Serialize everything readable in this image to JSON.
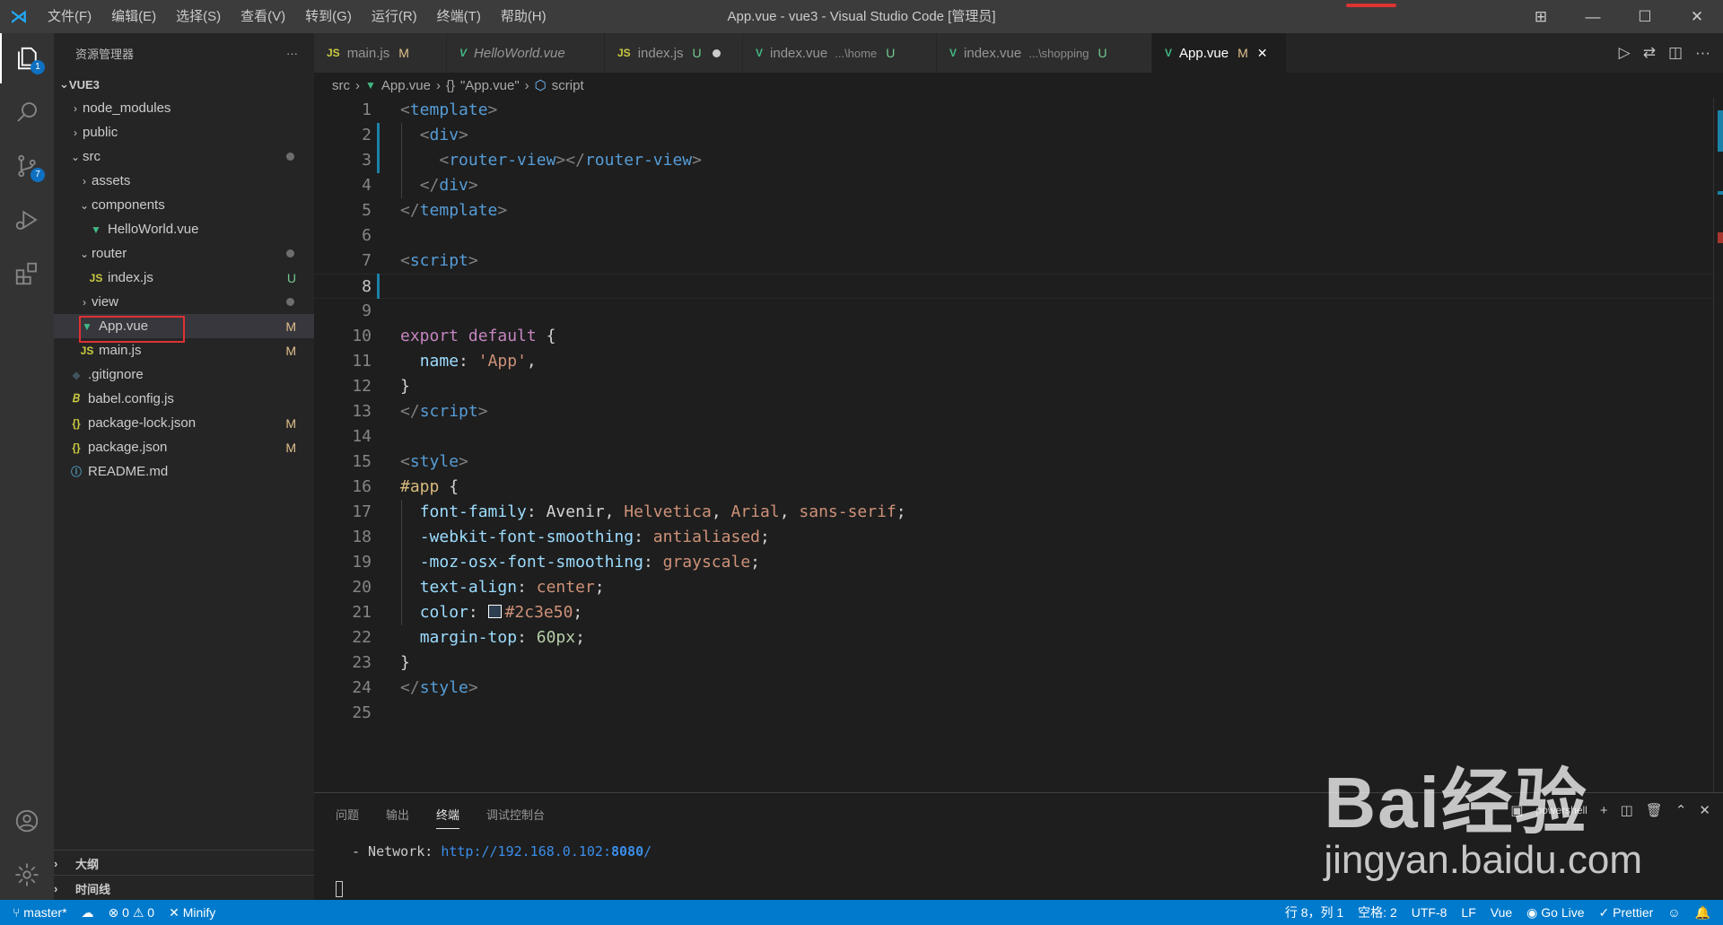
{
  "titlebar": {
    "menu": [
      "文件(F)",
      "编辑(E)",
      "选择(S)",
      "查看(V)",
      "转到(G)",
      "运行(R)",
      "终端(T)",
      "帮助(H)"
    ],
    "title": "App.vue - vue3 - Visual Studio Code [管理员]"
  },
  "activity": {
    "explorer_badge": "1",
    "scm_badge": "7"
  },
  "sidebar": {
    "header": "资源管理器",
    "more": "···",
    "root": "VUE3",
    "items": [
      {
        "label": "node_modules",
        "status": ""
      },
      {
        "label": "public",
        "status": ""
      },
      {
        "label": "src",
        "status": ""
      },
      {
        "label": "assets",
        "status": ""
      },
      {
        "label": "components",
        "status": ""
      },
      {
        "label": "HelloWorld.vue",
        "status": ""
      },
      {
        "label": "router",
        "status": ""
      },
      {
        "label": "index.js",
        "status": "U"
      },
      {
        "label": "view",
        "status": ""
      },
      {
        "label": "App.vue",
        "status": "M"
      },
      {
        "label": "main.js",
        "status": "M"
      },
      {
        "label": ".gitignore",
        "status": ""
      },
      {
        "label": "babel.config.js",
        "status": ""
      },
      {
        "label": "package-lock.json",
        "status": "M"
      },
      {
        "label": "package.json",
        "status": "M"
      },
      {
        "label": "README.md",
        "status": ""
      }
    ],
    "icon_js": "JS",
    "icon_json": "{}",
    "outline": "大纲",
    "timeline": "时间线"
  },
  "tabs": [
    {
      "icon": "JS",
      "label": "main.js",
      "status": "M"
    },
    {
      "icon": "V",
      "label": "HelloWorld.vue",
      "status": ""
    },
    {
      "icon": "JS",
      "label": "index.js",
      "status": "U"
    },
    {
      "icon": "V",
      "label": "index.vue",
      "sub": "...\\home",
      "status": "U"
    },
    {
      "icon": "V",
      "label": "index.vue",
      "sub": "...\\shopping",
      "status": "U"
    },
    {
      "icon": "V",
      "label": "App.vue",
      "status": "M"
    }
  ],
  "breadcrumb": {
    "src": "src",
    "file": "App.vue",
    "braces": "{}",
    "obj": "\"App.vue\"",
    "sym": "script"
  },
  "editor": {
    "line_numbers": [
      "1",
      "2",
      "3",
      "4",
      "5",
      "6",
      "7",
      "8",
      "9",
      "10",
      "11",
      "12",
      "13",
      "14",
      "15",
      "16",
      "17",
      "18",
      "19",
      "20",
      "21",
      "22",
      "23",
      "24",
      "25"
    ],
    "current_line": 8,
    "color_value": "#2c3e50"
  },
  "panel": {
    "tabs": [
      "问题",
      "输出",
      "终端",
      "调试控制台"
    ],
    "active_tab": "终端",
    "terminal_prefix": "- Network: ",
    "terminal_url": "http://192.168.0.102:",
    "terminal_port": "8080",
    "terminal_suffix": "/",
    "shell": "powershell"
  },
  "statusbar": {
    "branch": "master*",
    "errors": "0",
    "warnings": "0",
    "minify": "Minify",
    "position": "行 8，列 1",
    "spaces": "空格: 2",
    "encoding": "UTF-8",
    "eol": "LF",
    "language": "Vue",
    "golive": "Go Live",
    "prettier": "Prettier"
  },
  "watermark": {
    "brand": "Bai经验",
    "site": "jingyan.baidu.com"
  },
  "colors": {
    "status_bg": "#007acc",
    "vue_green": "#41b883",
    "js_yellow": "#cbcb41",
    "selection_box": "#e03131"
  }
}
